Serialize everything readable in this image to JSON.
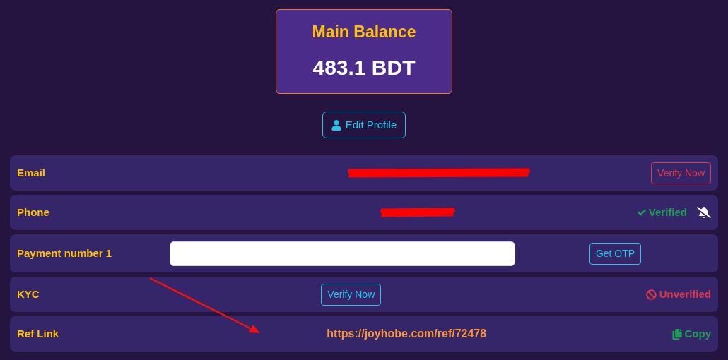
{
  "balance": {
    "title": "Main Balance",
    "amount": "483.1 BDT"
  },
  "edit_profile_button": "Edit Profile",
  "rows": [
    {
      "kind": "redacted_action",
      "label": "Email",
      "action": "Verify Now"
    },
    {
      "kind": "redacted_status",
      "label": "Phone",
      "status": "Verified",
      "verified": true
    },
    {
      "kind": "input",
      "label": "Payment number 1",
      "action": "Get OTP"
    },
    {
      "kind": "button_status",
      "label": "KYC",
      "action": "Verify Now",
      "status": "Unverified",
      "verified": false
    },
    {
      "kind": "link",
      "label": "Ref Link",
      "link": "https://joyhobe.com/ref/72478",
      "action": "Copy"
    }
  ]
}
